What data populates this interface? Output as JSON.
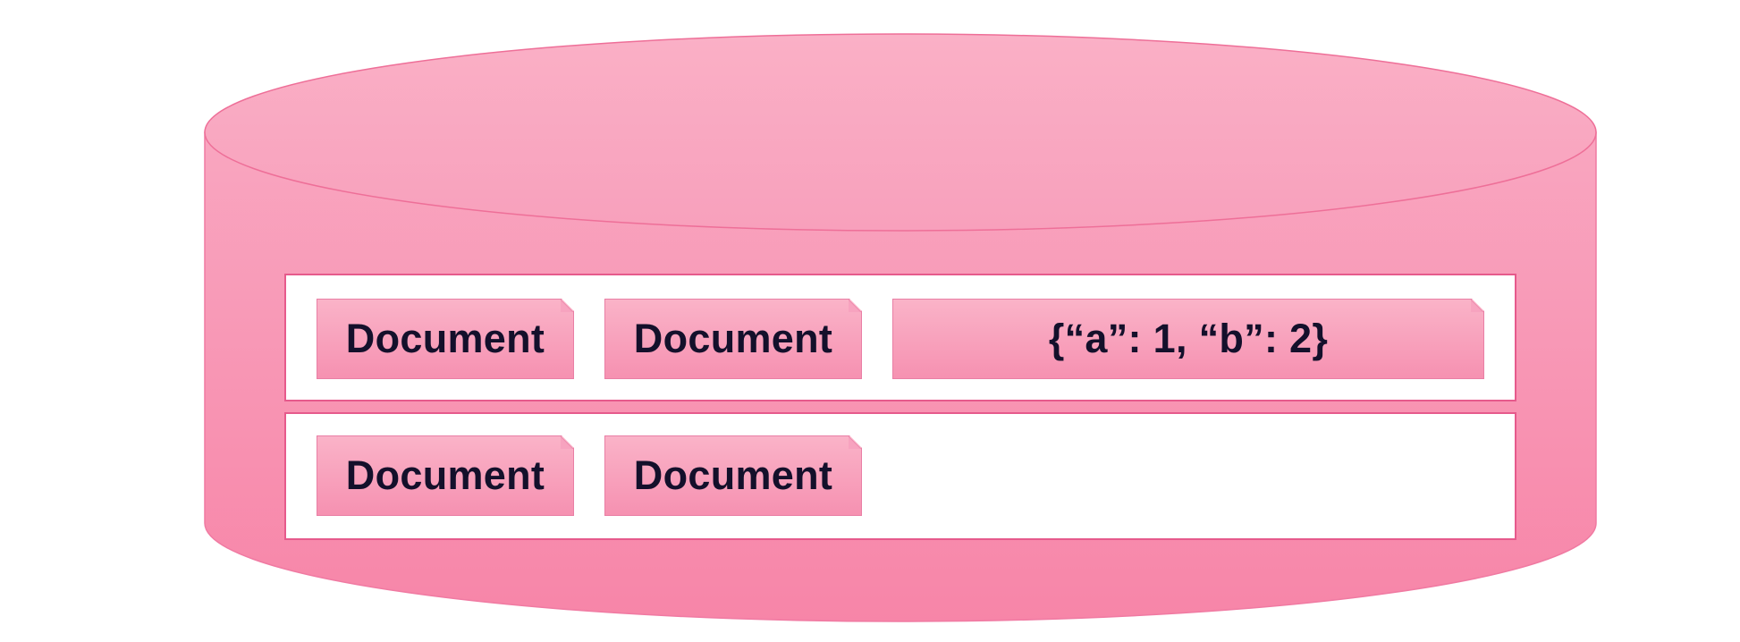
{
  "colors": {
    "cylinder_top": "#f9a9c2",
    "cylinder_bottom": "#f787a9",
    "outline": "#e65a8c",
    "document_fill_top": "#fab3c8",
    "document_fill_bottom": "#f691b1",
    "text": "#14102b"
  },
  "database": {
    "shape": "cylinder-icon",
    "collections": [
      {
        "documents": [
          {
            "label": "Document"
          },
          {
            "label": "Document"
          },
          {
            "label": "{“a”: 1, “b”: 2}"
          }
        ]
      },
      {
        "documents": [
          {
            "label": "Document"
          },
          {
            "label": "Document"
          }
        ]
      }
    ]
  }
}
